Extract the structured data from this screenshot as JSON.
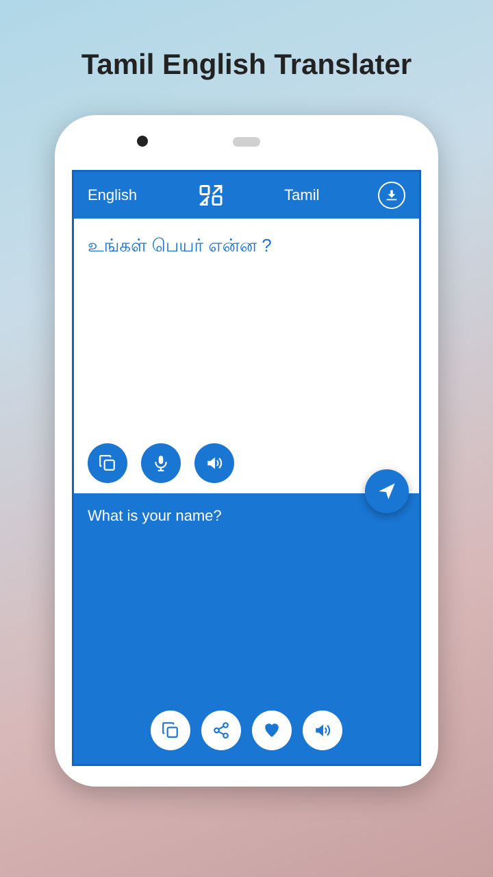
{
  "app": {
    "title": "Tamil English Translater"
  },
  "toolbar": {
    "source_lang": "English",
    "target_lang": "Tamil",
    "swap_label": "swap-languages",
    "download_label": "download"
  },
  "input": {
    "text": "உங்கள் பெயர் என்ன ?",
    "copy_label": "Copy",
    "mic_label": "Microphone",
    "volume_label": "Volume",
    "send_label": "Send"
  },
  "output": {
    "text": "What is your name?",
    "copy_label": "Copy",
    "share_label": "Share",
    "favorite_label": "Favorite",
    "volume_label": "Volume"
  }
}
